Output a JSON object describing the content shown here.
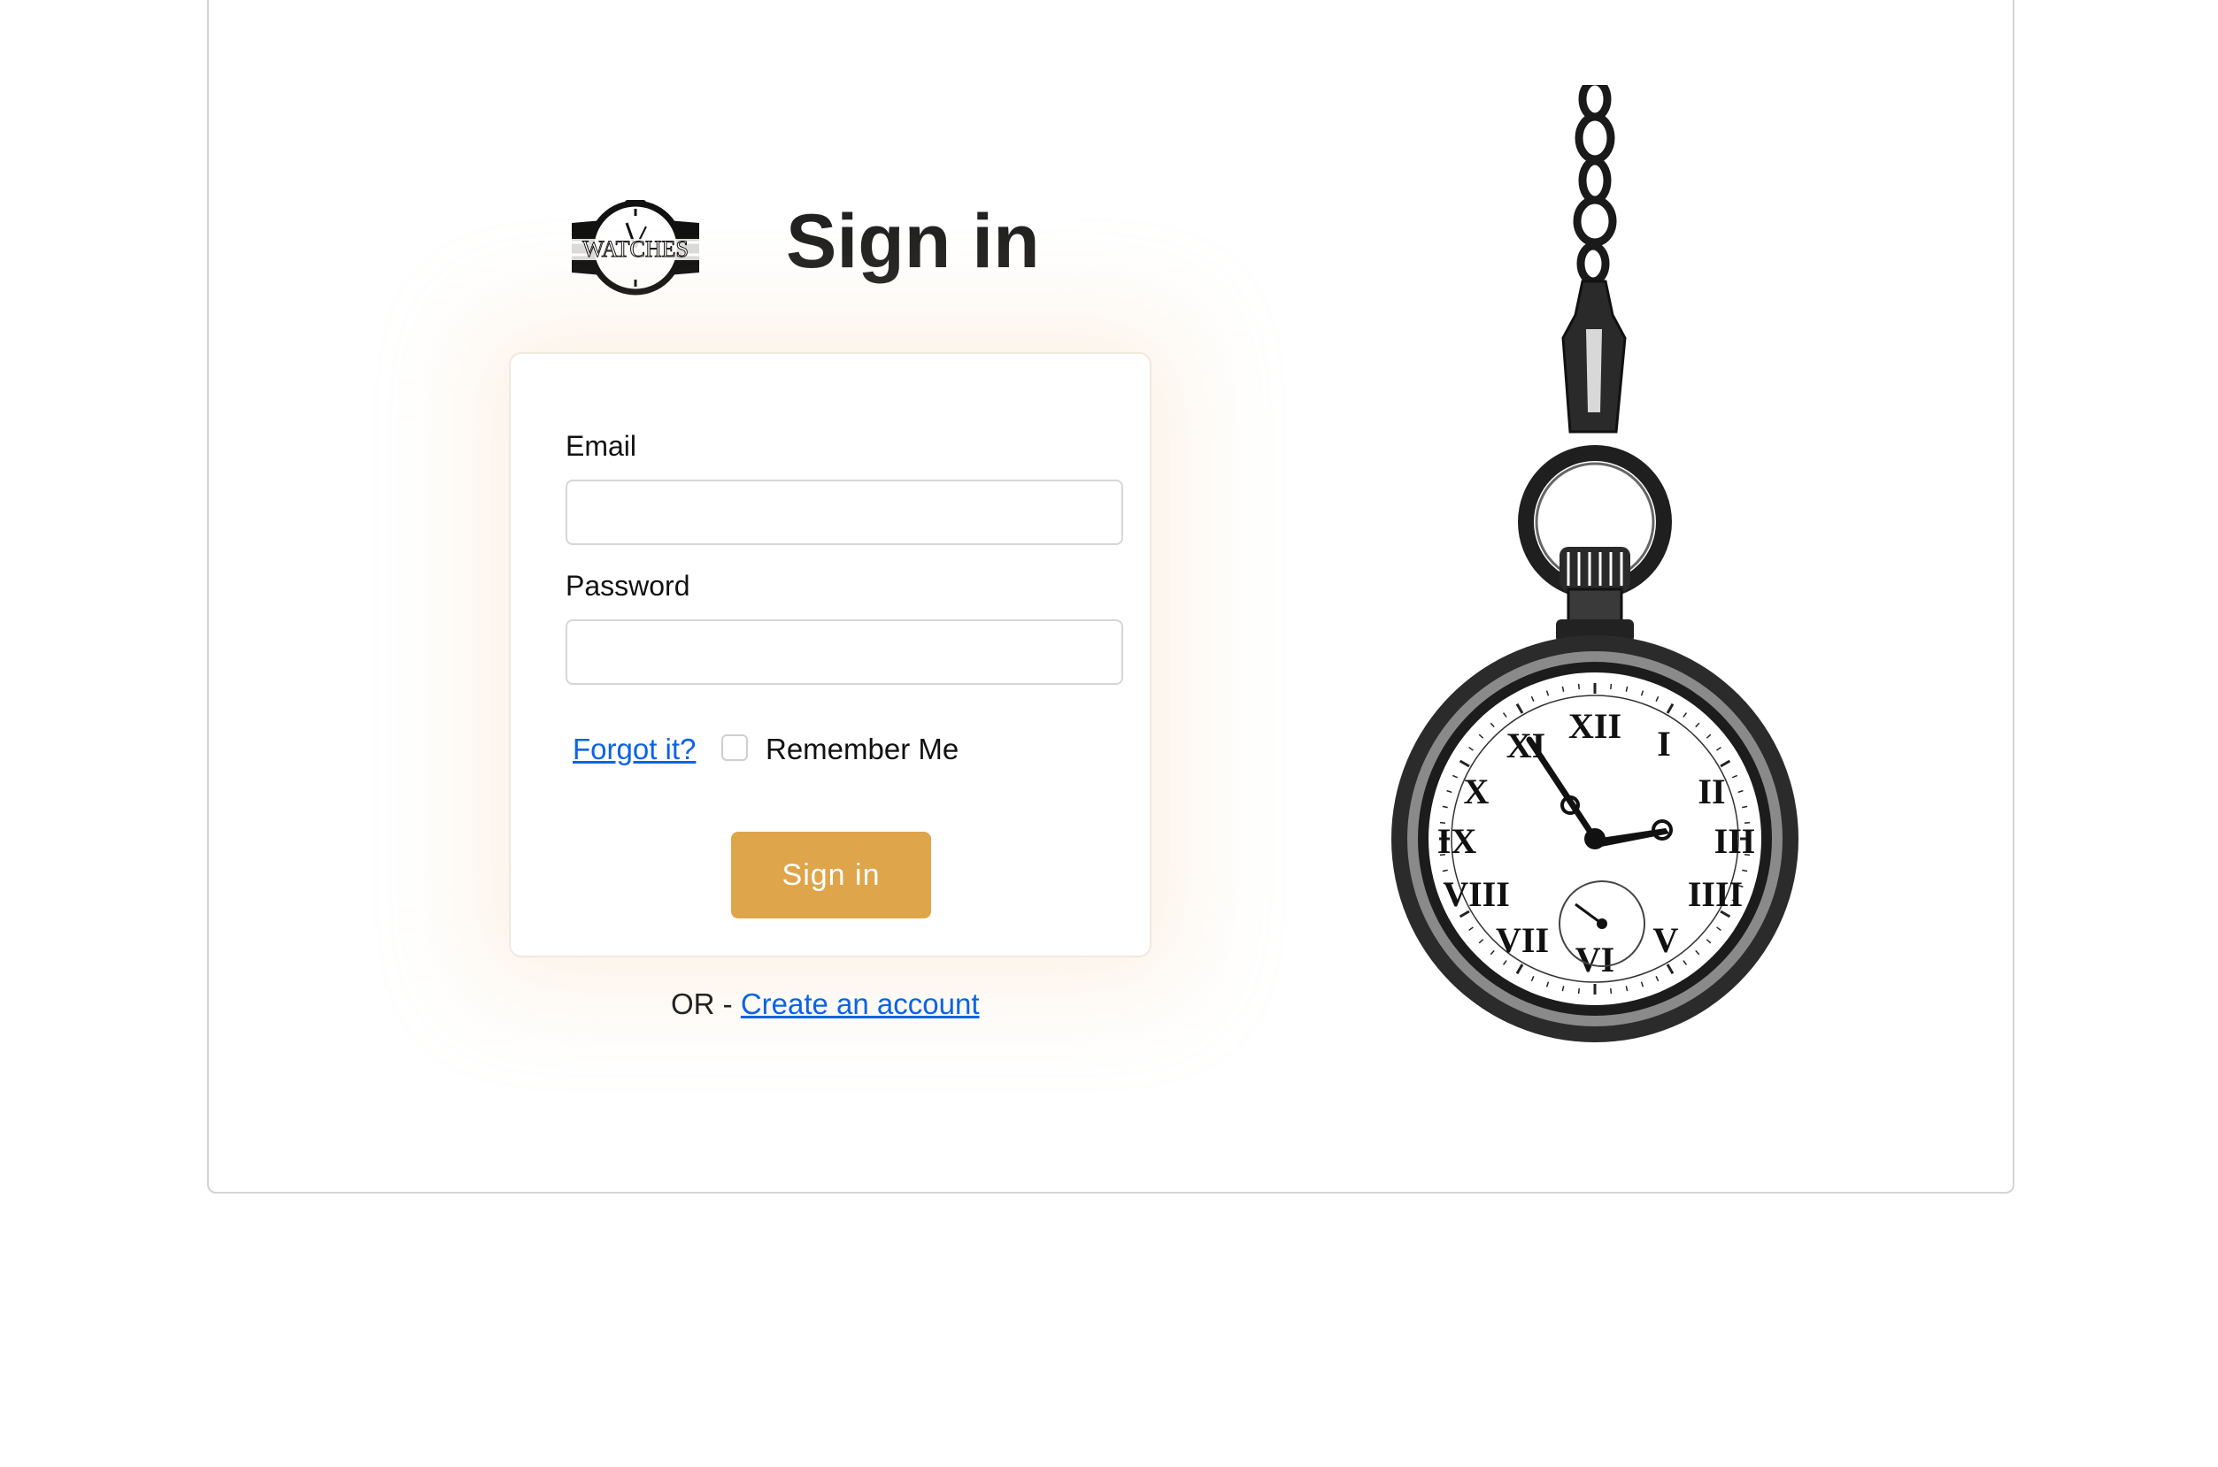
{
  "logo": {
    "text": "WATCHES",
    "icon": "watch-logo-icon"
  },
  "header": {
    "title": "Sign in"
  },
  "form": {
    "email_label": "Email",
    "email_value": "",
    "email_placeholder": "",
    "password_label": "Password",
    "password_value": "",
    "password_placeholder": "",
    "forgot_link": "Forgot it?",
    "remember_label": "Remember Me",
    "remember_checked": false,
    "submit_label": "Sign in"
  },
  "footer": {
    "or_text": "OR - ",
    "create_account_link": "Create an account"
  },
  "illustration": {
    "icon": "pocket-watch-illustration"
  },
  "colors": {
    "accent": "#dea54b",
    "link": "#0b63e5",
    "title": "#222222",
    "border": "#d4d4d4"
  }
}
